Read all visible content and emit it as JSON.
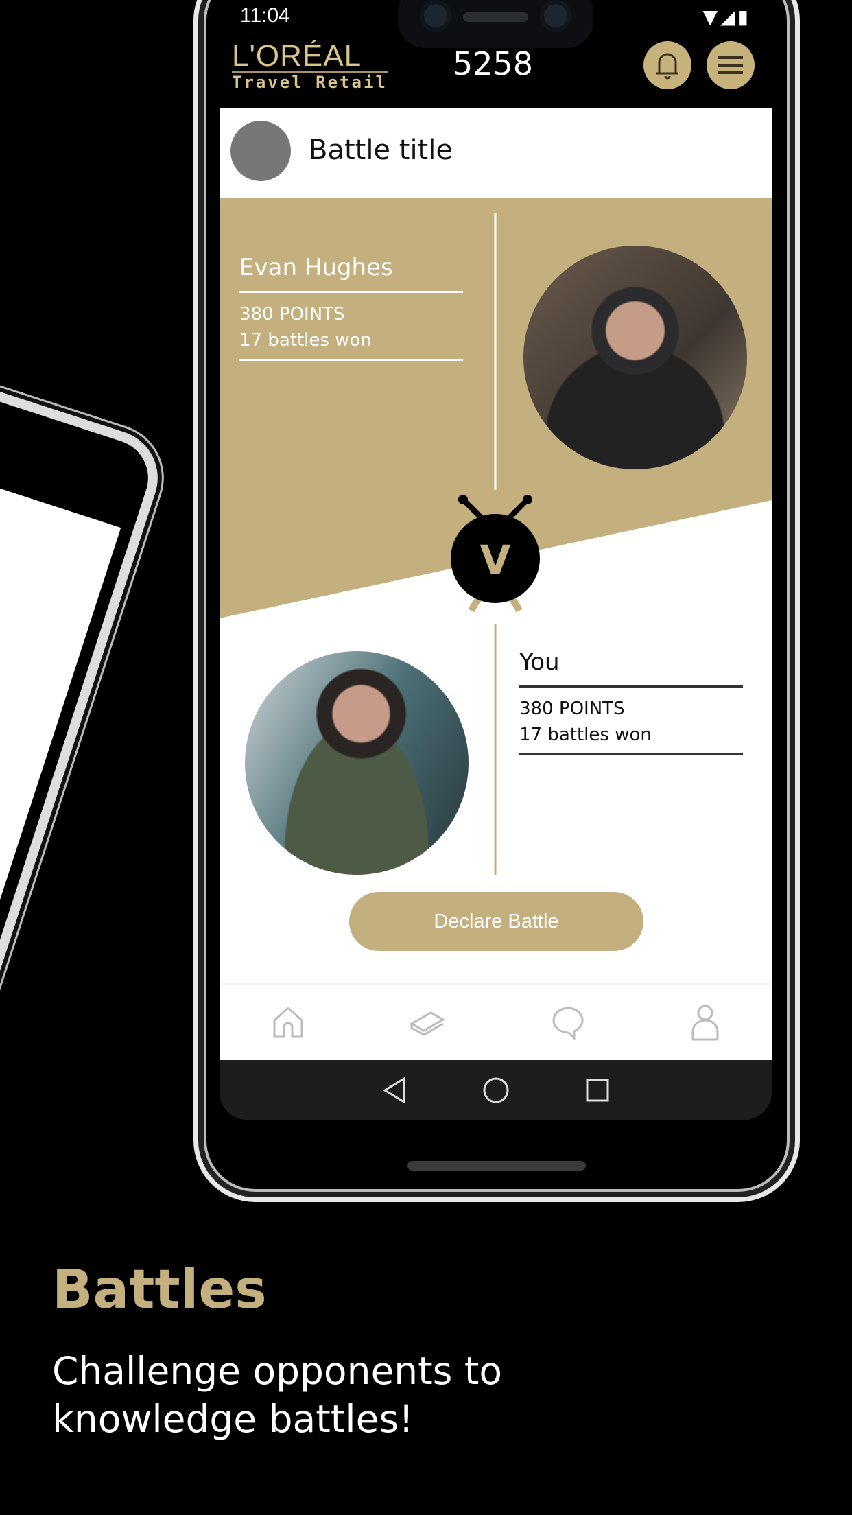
{
  "status_bar": {
    "time": "11:04"
  },
  "header": {
    "logo_line1": "L'ORÉAL",
    "logo_line2": "Travel Retail",
    "points": "5258",
    "icons": [
      "bell-icon",
      "menu-icon"
    ]
  },
  "battle": {
    "title": "Battle title",
    "opponent": {
      "name": "Evan Hughes",
      "points": "380 POINTS",
      "battles": "17 battles won"
    },
    "you": {
      "name": "You",
      "points": "380 POINTS",
      "battles": "17 battles won"
    },
    "emblem_letter": "V",
    "declare_label": "Declare Battle"
  },
  "bottom_nav": [
    "home-icon",
    "book-icon",
    "chat-icon",
    "profile-icon"
  ],
  "android_nav": [
    "back-icon",
    "home-circle-icon",
    "recents-icon"
  ],
  "promo": {
    "heading": "Battles",
    "subtitle_line1": "Challenge opponents to",
    "subtitle_line2": "knowledge battles!"
  },
  "colors": {
    "gold": "#c4b07e",
    "background": "#000000"
  }
}
